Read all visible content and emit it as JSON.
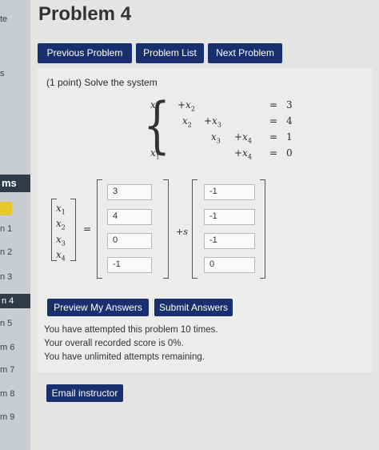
{
  "sidebar": {
    "fragments": [
      "te",
      "",
      "s",
      "ms",
      "n 1",
      "n 2",
      "n 3",
      "n 4",
      "n 5",
      "m 6",
      "m 7",
      "m 8",
      "m 9"
    ]
  },
  "page": {
    "title": "Problem 4"
  },
  "nav": {
    "previous": "Previous Problem",
    "list": "Problem List",
    "next": "Next Problem"
  },
  "problem": {
    "prompt": "(1 point) Solve the system",
    "system": [
      {
        "terms": [
          "x1",
          "+x2",
          "",
          ""
        ],
        "rhs": "3"
      },
      {
        "terms": [
          "",
          "x2",
          "+x3",
          ""
        ],
        "rhs": "4"
      },
      {
        "terms": [
          "",
          "",
          "x3",
          "+x4"
        ],
        "rhs": "1"
      },
      {
        "terms": [
          "x1",
          "",
          "",
          "+x4"
        ],
        "rhs": "0"
      }
    ],
    "eq": "=",
    "vector_labels": [
      "x1",
      "x2",
      "x3",
      "x4"
    ],
    "particular": [
      "3",
      "4",
      "0",
      "-1"
    ],
    "direction": [
      "-1",
      "-1",
      "-1",
      "0"
    ],
    "plus_s": "+s"
  },
  "actions": {
    "preview": "Preview My Answers",
    "submit": "Submit Answers",
    "email": "Email instructor"
  },
  "status": {
    "attempted": "You have attempted this problem 10 times.",
    "score": "Your overall recorded score is 0%.",
    "remaining": "You have unlimited attempts remaining."
  },
  "colors": {
    "button": "#1a2f6e",
    "accent_yellow": "#e6c62b",
    "sidebar_dark": "#2f3b49"
  }
}
